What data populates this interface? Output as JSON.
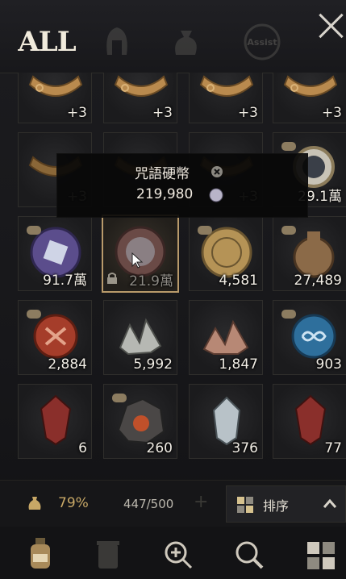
{
  "tabs": {
    "all_label": "ALL",
    "assist_label": "Assist"
  },
  "tooltip": {
    "item_name": "咒語硬幣",
    "price": "219,980"
  },
  "rows": [
    {
      "items": [
        {
          "qty": "+3",
          "icon": "gold-collar-icon"
        },
        {
          "qty": "+3",
          "icon": "gold-collar-icon"
        },
        {
          "qty": "+3",
          "icon": "gold-collar-icon"
        },
        {
          "qty": "+3",
          "icon": "gold-collar-icon"
        }
      ]
    },
    {
      "items": [
        {
          "qty": "+3",
          "icon": "gold-collar-icon"
        },
        {
          "qty": "",
          "icon": "gold-collar-icon"
        },
        {
          "qty": "+3",
          "icon": "gold-collar-icon"
        },
        {
          "qty": "29.1萬",
          "icon": "silver-medallion-icon"
        }
      ]
    },
    {
      "items": [
        {
          "qty": "91.7萬",
          "icon": "purple-coin-icon"
        },
        {
          "qty": "21.9萬",
          "icon": "spell-coin-icon"
        },
        {
          "qty": "4,581",
          "icon": "gold-coin-icon"
        },
        {
          "qty": "27,489",
          "icon": "bronze-pouch-icon"
        }
      ]
    },
    {
      "items": [
        {
          "qty": "2,884",
          "icon": "red-seal-icon"
        },
        {
          "qty": "5,992",
          "icon": "silver-ore-icon"
        },
        {
          "qty": "1,847",
          "icon": "copper-ore-icon"
        },
        {
          "qty": "903",
          "icon": "blue-seal-icon"
        }
      ]
    },
    {
      "items": [
        {
          "qty": "6",
          "icon": "red-crystal-icon"
        },
        {
          "qty": "260",
          "icon": "ember-ore-icon"
        },
        {
          "qty": "376",
          "icon": "white-crystal-icon"
        },
        {
          "qty": "77",
          "icon": "red-crystal-icon"
        }
      ]
    }
  ],
  "bottom_bar": {
    "weight_percent": "79%",
    "capacity": "447/500",
    "sort_label": "排序"
  },
  "toolbar": {
    "icons": [
      "potion-icon",
      "trash-icon",
      "zoom-in-icon",
      "search-icon",
      "grid-icon"
    ]
  }
}
